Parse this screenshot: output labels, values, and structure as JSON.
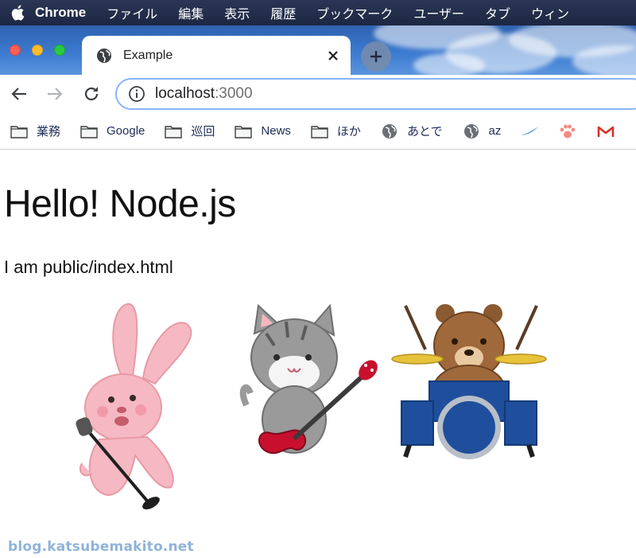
{
  "menubar": {
    "app_name": "Chrome",
    "items": [
      "ファイル",
      "編集",
      "表示",
      "履歴",
      "ブックマーク",
      "ユーザー",
      "タブ",
      "ウィン"
    ]
  },
  "tab": {
    "title": "Example"
  },
  "omnibox": {
    "host": "localhost",
    "port": ":3000"
  },
  "bookmarks": [
    {
      "label": "業務",
      "icon": "folder-icon"
    },
    {
      "label": "Google",
      "icon": "folder-icon"
    },
    {
      "label": "巡回",
      "icon": "folder-icon"
    },
    {
      "label": "News",
      "icon": "folder-icon"
    },
    {
      "label": "ほか",
      "icon": "folder-icon"
    },
    {
      "label": "あとで",
      "icon": "globe-icon"
    },
    {
      "label": "az",
      "icon": "globe-icon"
    },
    {
      "label": "",
      "icon": "feather-icon"
    },
    {
      "label": "",
      "icon": "paw-icon"
    },
    {
      "label": "",
      "icon": "gmail-icon"
    }
  ],
  "page": {
    "heading": "Hello! Node.js",
    "paragraph": "I am public/index.html",
    "images": [
      "rabbit-singer-illustration",
      "cat-guitarist-illustration",
      "bear-drummer-illustration"
    ]
  },
  "watermark": "blog.katsubemakito.net",
  "colors": {
    "menubar": "#1f2a44",
    "omnibox_border": "#8ab4f8",
    "bookmark_text": "#1d2b57",
    "watermark": "#8fb3d9"
  }
}
